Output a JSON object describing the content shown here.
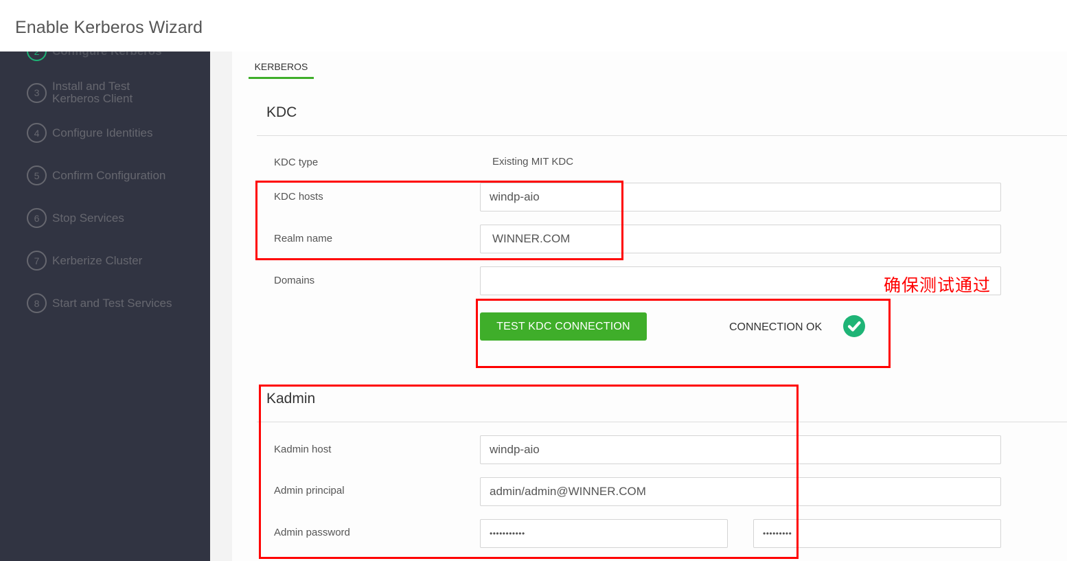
{
  "header": {
    "title": "Enable Kerberos Wizard"
  },
  "sidebar": {
    "steps": [
      {
        "num": "2",
        "label": "Configure Kerberos",
        "state": "active"
      },
      {
        "num": "3",
        "label": "Install and Test\nKerberos Client",
        "line1": "Install and Test",
        "line2": "Kerberos Client",
        "state": "pending"
      },
      {
        "num": "4",
        "label": "Configure Identities",
        "state": "pending"
      },
      {
        "num": "5",
        "label": "Confirm Configuration",
        "state": "pending"
      },
      {
        "num": "6",
        "label": "Stop Services",
        "state": "pending"
      },
      {
        "num": "7",
        "label": "Kerberize Cluster",
        "state": "pending"
      },
      {
        "num": "8",
        "label": "Start and Test Services",
        "state": "pending"
      }
    ]
  },
  "tabs": [
    {
      "label": "KERBEROS",
      "active": true
    }
  ],
  "kdc": {
    "title": "KDC",
    "kdc_type": {
      "label": "KDC type",
      "value": "Existing MIT KDC"
    },
    "kdc_hosts": {
      "label": "KDC hosts",
      "value": "windp-aio"
    },
    "realm_name": {
      "label": "Realm name",
      "value": "WINNER.COM"
    },
    "domains": {
      "label": "Domains",
      "value": ""
    },
    "test_button": "TEST KDC CONNECTION",
    "connection_status": "CONNECTION OK"
  },
  "kadmin": {
    "title": "Kadmin",
    "kadmin_host": {
      "label": "Kadmin host",
      "value": "windp-aio"
    },
    "admin_principal": {
      "label": "Admin principal",
      "value": "admin/admin@WINNER.COM"
    },
    "admin_password": {
      "label": "Admin password",
      "value": "•••••••••••",
      "confirm_value": "•••••••••"
    }
  },
  "annotation": {
    "text": "确保测试通过",
    "color": "#ff0000"
  },
  "colors": {
    "sidebar_bg": "#313442",
    "accent_green": "#3fae2a",
    "success_icon": "#1eb476",
    "annotation_red": "#ff0000"
  }
}
